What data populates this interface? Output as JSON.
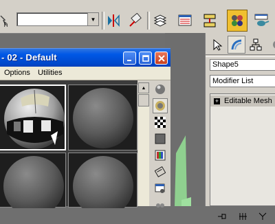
{
  "toolbar": {
    "combo_value": "",
    "icons": [
      "select-and-link-icon",
      "mirror-icon",
      "align-icon",
      "layer-manager-icon",
      "curve-editor-icon",
      "schematic-view-icon",
      "material-editor-icon",
      "render-teapot-icon"
    ]
  },
  "material_editor": {
    "title": "- 02 - Default",
    "menu": [
      "Options",
      "Utilities"
    ],
    "slots": [
      {
        "type": "sphere",
        "active": true,
        "material": "reflective"
      },
      {
        "type": "sphere",
        "active": false,
        "material": "standard"
      },
      {
        "type": "sphere",
        "active": false,
        "material": "standard"
      },
      {
        "type": "sphere",
        "active": false,
        "material": "standard"
      }
    ],
    "side_tools": [
      "sample-sphere-icon",
      "backlight-icon",
      "checker-background-icon",
      "sample-uv-tiling-icon",
      "video-color-check-icon",
      "make-preview-icon",
      "options-icon"
    ]
  },
  "command_panel": {
    "tabs": [
      "create-tab",
      "modify-tab",
      "hierarchy-tab",
      "motion-tab"
    ],
    "object_name": "Shape5",
    "modifier_list": "Modifier List",
    "stack": [
      {
        "label": "Editable Mesh",
        "expand": "+"
      }
    ]
  },
  "colors": {
    "xp_title_blue": "#0058e6",
    "panel_gray": "#d4d0c8",
    "slot_background": "#1e1e1e"
  }
}
